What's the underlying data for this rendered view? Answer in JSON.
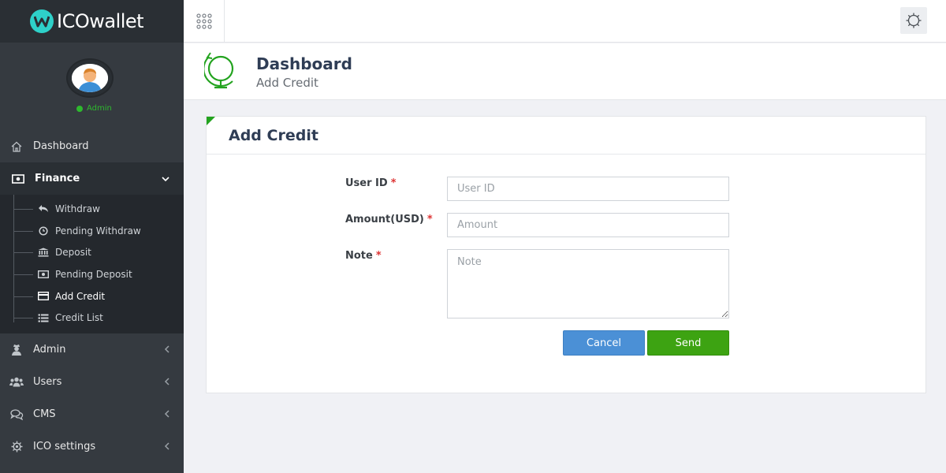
{
  "app": {
    "brand": "ICOwallet",
    "accent": "#23a31f"
  },
  "profile": {
    "role": "Admin",
    "status_color": "#2eb82e"
  },
  "sidebar": {
    "items": [
      {
        "label": "Dashboard",
        "icon": "home-icon"
      },
      {
        "label": "Finance",
        "icon": "money-icon",
        "expanded": true
      },
      {
        "label": "Admin",
        "icon": "user-secret-icon"
      },
      {
        "label": "Users",
        "icon": "users-icon"
      },
      {
        "label": "CMS",
        "icon": "comments-icon"
      },
      {
        "label": "ICO settings",
        "icon": "gear-icon"
      }
    ],
    "finance_sub": [
      {
        "label": "Withdraw",
        "icon": "reply-icon"
      },
      {
        "label": "Pending Withdraw",
        "icon": "clock-icon"
      },
      {
        "label": "Deposit",
        "icon": "bank-icon"
      },
      {
        "label": "Pending Deposit",
        "icon": "money-icon"
      },
      {
        "label": "Add Credit",
        "icon": "credit-card-icon",
        "active": true
      },
      {
        "label": "Credit List",
        "icon": "list-icon"
      }
    ]
  },
  "page_header": {
    "title": "Dashboard",
    "subtitle": "Add Credit"
  },
  "card": {
    "title": "Add Credit"
  },
  "form": {
    "user_id": {
      "label": "User ID",
      "required": "*",
      "placeholder": "User ID"
    },
    "amount": {
      "label": "Amount(USD)",
      "required": "*",
      "placeholder": "Amount"
    },
    "note": {
      "label": "Note",
      "required": "*",
      "placeholder": "Note"
    },
    "cancel_label": "Cancel",
    "send_label": "Send"
  }
}
